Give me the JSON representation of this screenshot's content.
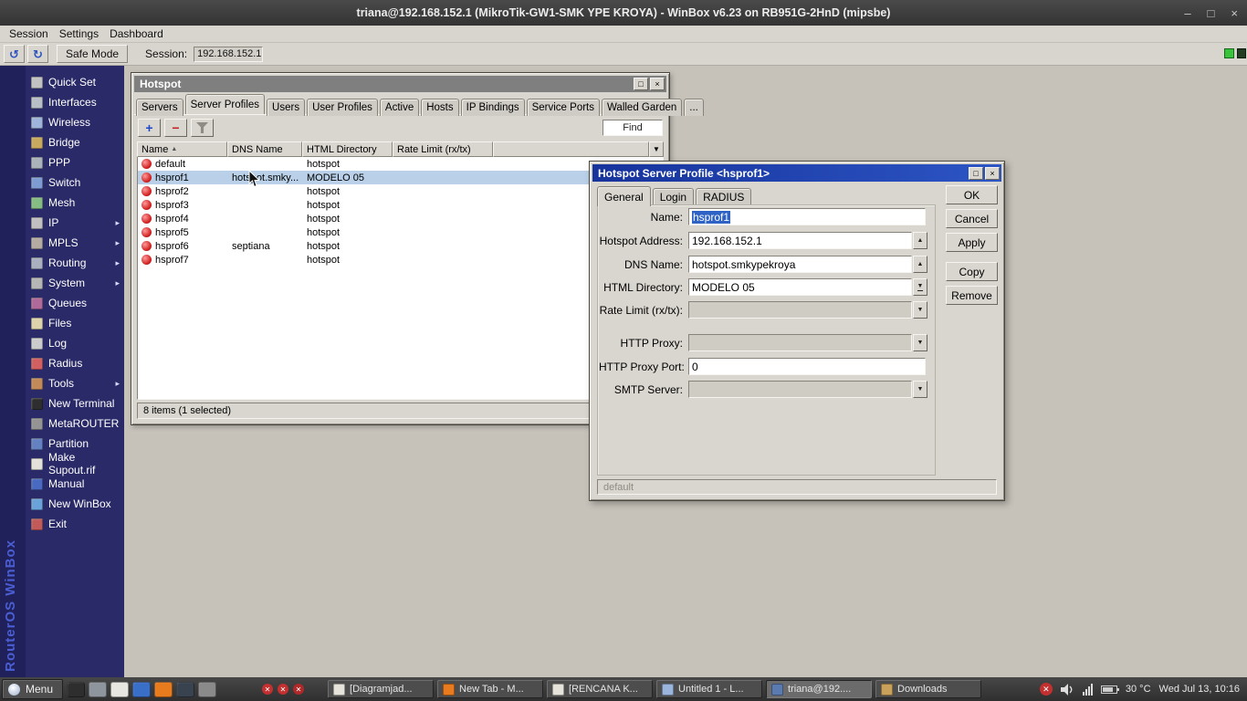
{
  "app": {
    "title": "triana@192.168.152.1 (MikroTik-GW1-SMK YPE KROYA) - WinBox v6.23 on RB951G-2HnD (mipsbe)",
    "controls": {
      "minimize": "–",
      "maximize": "□",
      "close": "×"
    },
    "menu_items": [
      "Session",
      "Settings",
      "Dashboard"
    ],
    "toolbar": {
      "undo_icon": "↺",
      "redo_icon": "↻",
      "safe_mode_label": "Safe Mode",
      "session_label": "Session:",
      "session_value": "192.168.152.1",
      "connection_color": "#39c23c"
    }
  },
  "sidebar": {
    "vertical_text": "RouterOS WinBox",
    "items": [
      {
        "label": "Quick Set",
        "icon": "quickset-icon",
        "color": "#c2c2c2"
      },
      {
        "label": "Interfaces",
        "icon": "interfaces-icon",
        "color": "#b9bfc6"
      },
      {
        "label": "Wireless",
        "icon": "wireless-icon",
        "color": "#9fb4da"
      },
      {
        "label": "Bridge",
        "icon": "bridge-icon",
        "color": "#c8aa5e"
      },
      {
        "label": "PPP",
        "icon": "ppp-icon",
        "color": "#aab2ba"
      },
      {
        "label": "Switch",
        "icon": "switch-icon",
        "color": "#7e9cd2"
      },
      {
        "label": "Mesh",
        "icon": "mesh-icon",
        "color": "#84bc84"
      },
      {
        "label": "IP",
        "icon": "ip-icon",
        "color": "#c0c0c0",
        "arrow": "▸"
      },
      {
        "label": "MPLS",
        "icon": "mpls-icon",
        "color": "#b4aca2",
        "arrow": "▸"
      },
      {
        "label": "Routing",
        "icon": "routing-icon",
        "color": "#aab0c0",
        "arrow": "▸"
      },
      {
        "label": "System",
        "icon": "system-icon",
        "color": "#b6b6b6",
        "arrow": "▸"
      },
      {
        "label": "Queues",
        "icon": "queues-icon",
        "color": "#b06a9a"
      },
      {
        "label": "Files",
        "icon": "files-icon",
        "color": "#ddd4ac"
      },
      {
        "label": "Log",
        "icon": "log-icon",
        "color": "#cccccc"
      },
      {
        "label": "Radius",
        "icon": "radius-icon",
        "color": "#d26060"
      },
      {
        "label": "Tools",
        "icon": "tools-icon",
        "color": "#c28a58",
        "arrow": "▸"
      },
      {
        "label": "New Terminal",
        "icon": "terminal-icon",
        "color": "#2e2e2e"
      },
      {
        "label": "MetaROUTER",
        "icon": "metarouter-icon",
        "color": "#949494"
      },
      {
        "label": "Partition",
        "icon": "partition-icon",
        "color": "#6482c2"
      },
      {
        "label": "Make Supout.rif",
        "icon": "supout-icon",
        "color": "#e2e2da"
      },
      {
        "label": "Manual",
        "icon": "manual-icon",
        "color": "#4a6ac2"
      },
      {
        "label": "New WinBox",
        "icon": "newwinbox-icon",
        "color": "#6aa2da"
      },
      {
        "label": "Exit",
        "icon": "exit-icon",
        "color": "#c25a5a"
      }
    ]
  },
  "hotspot": {
    "title": "Hotspot",
    "controls": {
      "maximize": "□",
      "close": "×"
    },
    "tabs": [
      "Servers",
      "Server Profiles",
      "Users",
      "User Profiles",
      "Active",
      "Hosts",
      "IP Bindings",
      "Service Ports",
      "Walled Garden",
      "..."
    ],
    "toolbar": {
      "add_icon": "+",
      "remove_icon": "−",
      "find_label": "Find"
    },
    "columns": {
      "name": "Name",
      "sort_indicator": "▲",
      "dns": "DNS Name",
      "html": "HTML Directory",
      "rate": "Rate Limit (rx/tx)",
      "menu_icon": "▼"
    },
    "rows": [
      {
        "name": "default",
        "dns": "",
        "html": "hotspot",
        "rate": ""
      },
      {
        "name": "hsprof1",
        "dns": "hotspot.smky...",
        "html": "MODELO 05",
        "rate": ""
      },
      {
        "name": "hsprof2",
        "dns": "",
        "html": "hotspot",
        "rate": ""
      },
      {
        "name": "hsprof3",
        "dns": "",
        "html": "hotspot",
        "rate": ""
      },
      {
        "name": "hsprof4",
        "dns": "",
        "html": "hotspot",
        "rate": ""
      },
      {
        "name": "hsprof5",
        "dns": "",
        "html": "hotspot",
        "rate": ""
      },
      {
        "name": "hsprof6",
        "dns": "septiana",
        "html": "hotspot",
        "rate": ""
      },
      {
        "name": "hsprof7",
        "dns": "",
        "html": "hotspot",
        "rate": ""
      }
    ],
    "status": "8 items (1 selected)"
  },
  "dialog": {
    "title": "Hotspot Server Profile <hsprof1>",
    "controls": {
      "maximize": "□",
      "close": "×"
    },
    "tabs": [
      "General",
      "Login",
      "RADIUS"
    ],
    "icons": {
      "up": "▲",
      "down": "▼"
    },
    "fields": {
      "name": {
        "label": "Name:",
        "value": "hsprof1"
      },
      "address": {
        "label": "Hotspot Address:",
        "value": "192.168.152.1"
      },
      "dns": {
        "label": "DNS Name:",
        "value": "hotspot.smkypekroya"
      },
      "html_dir": {
        "label": "HTML Directory:",
        "value": "MODELO 05"
      },
      "rate": {
        "label": "Rate Limit (rx/tx):",
        "value": ""
      },
      "proxy": {
        "label": "HTTP Proxy:",
        "value": ""
      },
      "proxy_port": {
        "label": "HTTP Proxy Port:",
        "value": "0"
      },
      "smtp": {
        "label": "SMTP Server:",
        "value": ""
      }
    },
    "buttons": [
      "OK",
      "Cancel",
      "Apply",
      "Copy",
      "Remove"
    ],
    "status": "default"
  },
  "taskbar": {
    "menu_label": "Menu",
    "launchers": [
      {
        "name": "terminal-launcher-icon",
        "color": "#2e2e2e"
      },
      {
        "name": "filemanager-launcher-icon",
        "color": "#8f959d"
      },
      {
        "name": "editor-launcher-icon",
        "color": "#e8e6e0"
      },
      {
        "name": "browser-launcher-icon",
        "color": "#3a6fc8"
      },
      {
        "name": "firefox-launcher-icon",
        "color": "#e87b1e"
      },
      {
        "name": "globe-launcher-icon",
        "color": "#39424f"
      },
      {
        "name": "media-launcher-icon",
        "color": "#8a8a8a"
      }
    ],
    "badge_icon": "✕",
    "badges": [
      {
        "name": "status-badge-1",
        "color": "#c43030"
      },
      {
        "name": "status-badge-2",
        "color": "#c43030"
      },
      {
        "name": "status-badge-3",
        "color": "#b02828"
      }
    ],
    "windows": [
      {
        "label": "[Diagramjad...",
        "color": "#e6e3da"
      },
      {
        "label": "New Tab - M...",
        "color": "#e87b1e"
      },
      {
        "label": "[RENCANA K...",
        "color": "#e6e3da"
      },
      {
        "label": "Untitled 1 - L...",
        "color": "#9ab4dc"
      },
      {
        "label": "triana@192....",
        "color": "#5a7ab0"
      },
      {
        "label": "Downloads",
        "color": "#c9a15a"
      }
    ],
    "temp": "30 °C",
    "clock": "Wed Jul 13, 10:16"
  }
}
